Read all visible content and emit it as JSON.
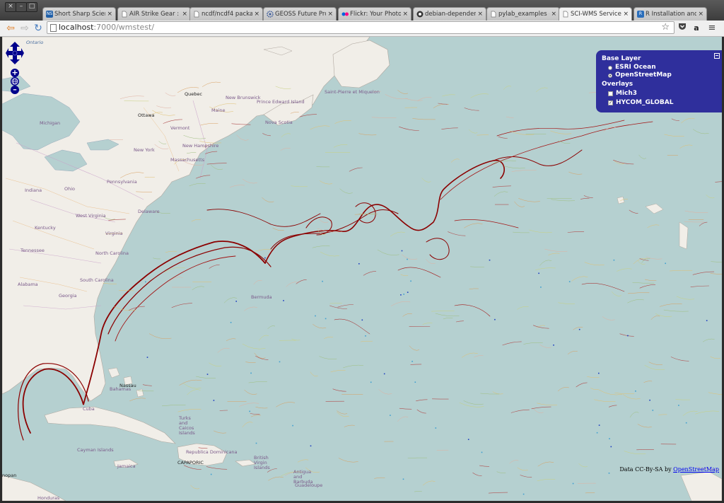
{
  "browser": {
    "window_buttons": [
      "×",
      "–",
      "□"
    ],
    "tabs": [
      {
        "label": "Short Sharp Scien",
        "favicon": "NS",
        "favicon_color": "#1f5fa8",
        "active": false
      },
      {
        "label": "AIR Strike Gear : A",
        "favicon": "doc",
        "favicon_color": "#888888",
        "active": false
      },
      {
        "label": "ncdf/ncdf4 packa",
        "favicon": "doc",
        "favicon_color": "#888888",
        "active": false
      },
      {
        "label": "GEOSS Future Pro",
        "favicon": "gear",
        "favicon_color": "#3b5a9a",
        "active": false
      },
      {
        "label": "Flickr: Your Photos",
        "favicon": "flickr",
        "favicon_color": "#ff0084",
        "active": false
      },
      {
        "label": "debian-dependenc",
        "favicon": "github",
        "favicon_color": "#333333",
        "active": false
      },
      {
        "label": "pylab_examples ex",
        "favicon": "doc",
        "favicon_color": "#888888",
        "active": false
      },
      {
        "label": "SCI-WMS Service T",
        "favicon": "doc",
        "favicon_color": "#888888",
        "active": true
      },
      {
        "label": "R Installation and",
        "favicon": "R",
        "favicon_color": "#2a6ebb",
        "active": false
      }
    ],
    "tab_close": "×",
    "url": {
      "host": "localhost",
      "path": ":7000/wmstest/"
    },
    "nav": {
      "back": "⇦",
      "forward": "⇨",
      "reload": "↻"
    },
    "toolbar_icons": {
      "star": "☆",
      "pocket": "pocket-icon",
      "amazon": "a",
      "menu": "≡"
    }
  },
  "map": {
    "layer_switcher": {
      "base_heading": "Base Layer",
      "base_layers": [
        {
          "label": "ESRI Ocean",
          "selected": false
        },
        {
          "label": "OpenStreetMap",
          "selected": true
        }
      ],
      "overlays_heading": "Overlays",
      "overlays": [
        {
          "label": "Mich3",
          "checked": false
        },
        {
          "label": "HYCOM_GLOBAL",
          "checked": true
        }
      ]
    },
    "attribution": {
      "prefix": "Data CC-By-SA by ",
      "link": "OpenStreetMap"
    },
    "labels": {
      "ontario": "Ontario",
      "quebec": "Quebec",
      "ottawa": "Ottawa",
      "new_brunswick": "New Brunswick",
      "prince_edward": "Prince Edward Island",
      "maine": "Maine",
      "nova_scotia": "Nova Scotia",
      "saint_pierre": "Saint-Pierre et Miquelon",
      "vermont": "Vermont",
      "new_hampshire": "New Hampshire",
      "massachusetts": "Massachusetts",
      "michigan": "Michigan",
      "new_york": "New York",
      "pennsylvania": "Pennsylvania",
      "indiana": "Indiana",
      "ohio": "Ohio",
      "west_virginia": "West Virginia",
      "delaware": "Delaware",
      "kentucky": "Kentucky",
      "virginia": "Virginia",
      "tennessee": "Tennessee",
      "north_carolina": "North Carolina",
      "south_carolina": "South Carolina",
      "alabama": "Alabama",
      "georgia": "Georgia",
      "bermuda": "Bermuda",
      "nassau": "Nassau",
      "bahamas": "Bahamas",
      "cuba": "Cuba",
      "turks": "Turks and Caicos Islands",
      "cayman": "Cayman Islands",
      "jamaica": "Jamaica",
      "dominicana": "Republica Dominicana",
      "port": "CAPAPORIC",
      "virgin": "British Virgin Islands",
      "antigua": "Antigua and Barbuda",
      "guadeloupe": "Guadeloupe",
      "honduras": "Honduras",
      "nopan": "nopan"
    },
    "colors": {
      "ocean": "#b5d0d0",
      "land": "#f1eee8",
      "current_strong": "#8b0000",
      "layer_switcher_bg": "#2f2f9c",
      "pan_zoom": "#00008b"
    }
  }
}
